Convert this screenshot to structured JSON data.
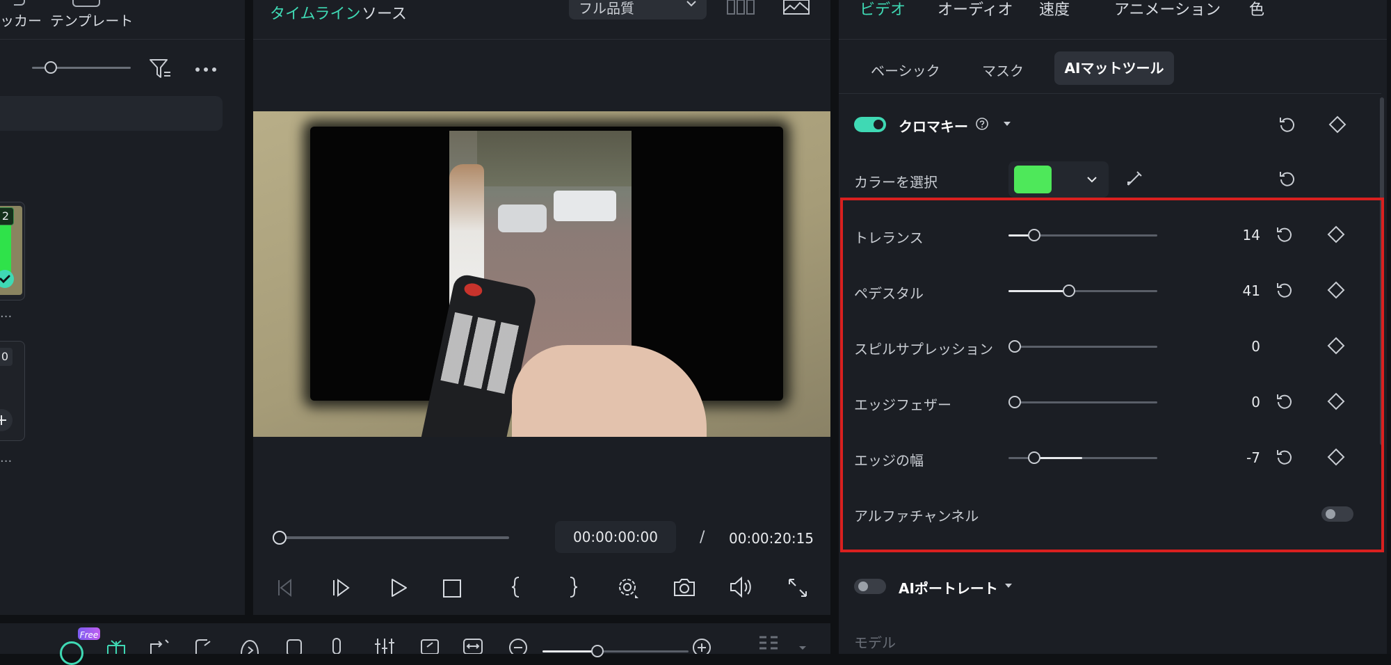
{
  "left_panel": {
    "tabs": [
      "ッカー",
      "テンプレート"
    ],
    "card1_badge": "2",
    "card1_caption": "...",
    "card2_badge": "0",
    "card2_caption": "..."
  },
  "player": {
    "tabs": {
      "timeline": "タイムライン",
      "source": "ソース"
    },
    "quality": "フル品質",
    "current_time": "00:00:00:00",
    "separator": "/",
    "total_time": "00:00:20:15"
  },
  "right_panel": {
    "top_tabs": [
      "ビデオ",
      "オーディオ",
      "速度",
      "アニメーション",
      "色"
    ],
    "sub_tabs": [
      "ベーシック",
      "マスク",
      "AIマットツール"
    ],
    "chroma": {
      "title": "クロマキー",
      "enabled": true,
      "color_label": "カラーを選択",
      "selected_color": "#4ee85a",
      "params": [
        {
          "label": "トレランス",
          "value": "14"
        },
        {
          "label": "ペデスタル",
          "value": "41"
        },
        {
          "label": "スピルサプレッション",
          "value": "0"
        },
        {
          "label": "エッジフェザー",
          "value": "0"
        },
        {
          "label": "エッジの幅",
          "value": "-7"
        }
      ],
      "alpha_label": "アルファチャンネル",
      "alpha_enabled": false
    },
    "ai_portrait": {
      "title": "AIポートレート",
      "enabled": false
    },
    "model_label": "モデル"
  },
  "bottom_toolbar": {
    "free_badge": "Free"
  },
  "colors": {
    "accent": "#3fd9b4",
    "highlight_border": "#d9201f",
    "panel_bg": "#1b1e24"
  }
}
